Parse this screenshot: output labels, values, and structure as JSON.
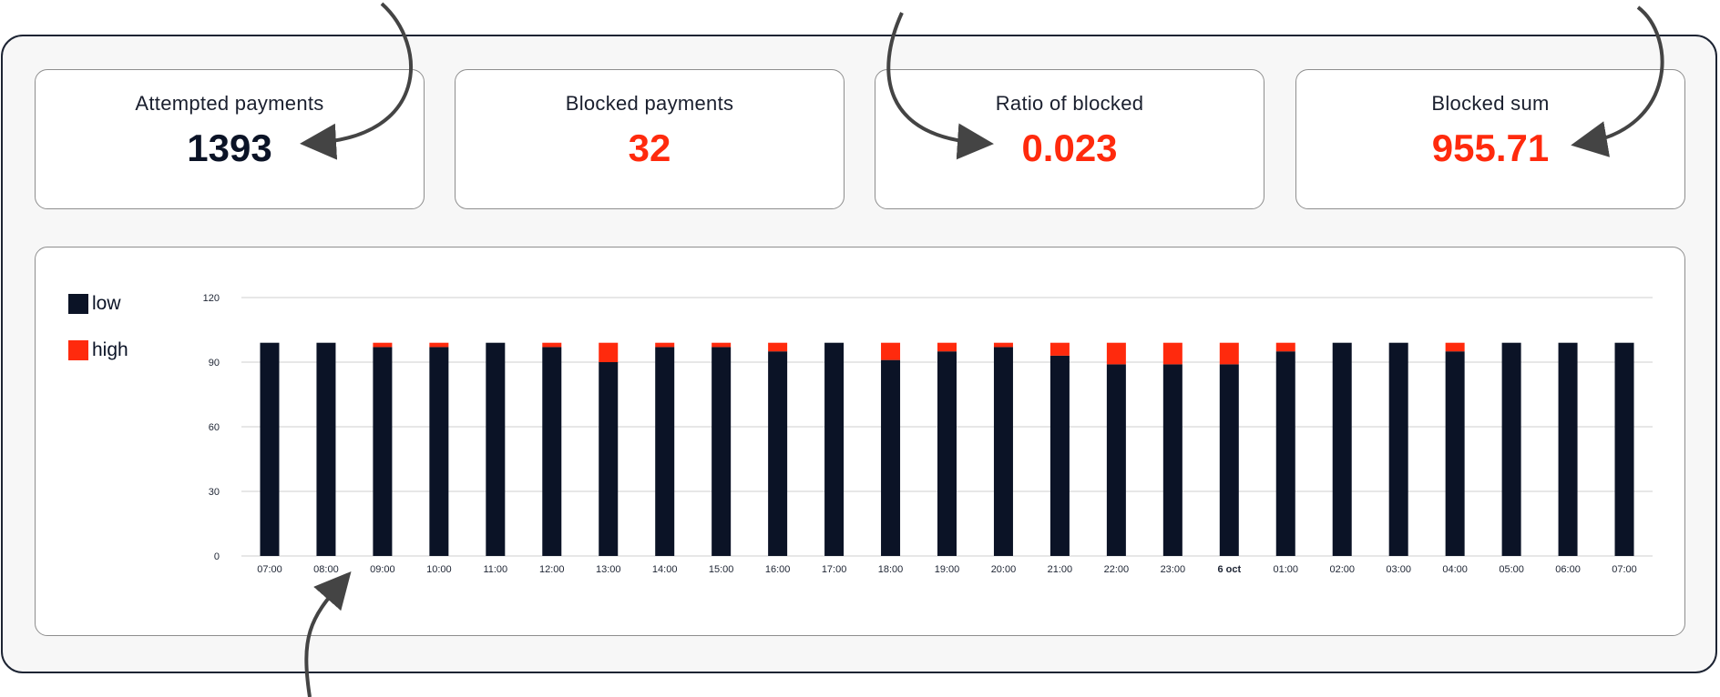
{
  "metrics": [
    {
      "label": "Attempted payments",
      "value": "1393",
      "color": "#0b1326"
    },
    {
      "label": "Blocked payments",
      "value": "32",
      "color": "#ff2a0d"
    },
    {
      "label": "Ratio of blocked",
      "value": "0.023",
      "color": "#ff2a0d"
    },
    {
      "label": "Blocked sum",
      "value": "955.71",
      "color": "#ff2a0d"
    }
  ],
  "colors": {
    "low": "#0b1326",
    "high": "#ff2a0d",
    "grid": "#cfcfcf"
  },
  "chart_data": {
    "type": "bar",
    "stacked": true,
    "legend_position": "left",
    "grid": true,
    "ylim": [
      0,
      120
    ],
    "yticks": [
      0,
      30,
      60,
      90,
      120
    ],
    "categories": [
      "07:00",
      "08:00",
      "09:00",
      "10:00",
      "11:00",
      "12:00",
      "13:00",
      "14:00",
      "15:00",
      "16:00",
      "17:00",
      "18:00",
      "19:00",
      "20:00",
      "21:00",
      "22:00",
      "23:00",
      "6 oct",
      "01:00",
      "02:00",
      "03:00",
      "04:00",
      "05:00",
      "06:00",
      "07:00"
    ],
    "bold_categories": [
      "6 oct"
    ],
    "series": [
      {
        "name": "low",
        "color": "#0b1326",
        "values": [
          99,
          99,
          97,
          97,
          99,
          97,
          90,
          97,
          97,
          95,
          99,
          91,
          95,
          97,
          93,
          89,
          89,
          89,
          95,
          99,
          99,
          95,
          99,
          99,
          99
        ]
      },
      {
        "name": "high",
        "color": "#ff2a0d",
        "values": [
          0,
          0,
          2,
          2,
          0,
          2,
          9,
          2,
          2,
          4,
          0,
          8,
          4,
          2,
          6,
          10,
          10,
          10,
          4,
          0,
          0,
          4,
          0,
          0,
          0
        ]
      }
    ]
  }
}
